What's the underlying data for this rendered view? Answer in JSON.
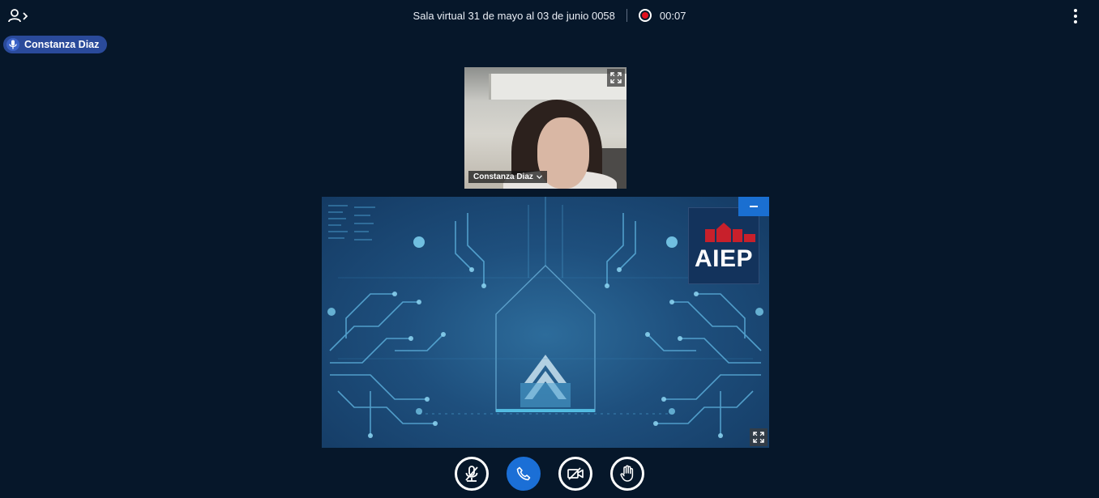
{
  "header": {
    "users_toggle_icon": "user-arrow-icon",
    "meeting_title": "Sala virtual 31 de mayo al 03 de junio 0058",
    "recording_time": "00:07",
    "recording_icon": "record-icon",
    "record_color": "#e10f1d",
    "options_icon": "kebab-menu-icon"
  },
  "talking_indicator": {
    "name": "Constanza Diaz",
    "icon": "microphone-icon",
    "color": "#2a4a9a"
  },
  "webcam": {
    "user_name": "Constanza Diaz",
    "dropdown_icon": "chevron-down-icon",
    "fullscreen_icon": "fullscreen-icon"
  },
  "presentation": {
    "logo_text": "AIEP",
    "minimize_icon": "minimize-icon",
    "fullscreen_icon": "fullscreen-icon",
    "accent_color": "#1a6fd1"
  },
  "controls": {
    "mute_icon": "microphone-muted-icon",
    "audio_icon": "phone-icon",
    "video_icon": "video-off-icon",
    "raise_hand_icon": "hand-icon",
    "primary_color": "#1b6fd6"
  }
}
